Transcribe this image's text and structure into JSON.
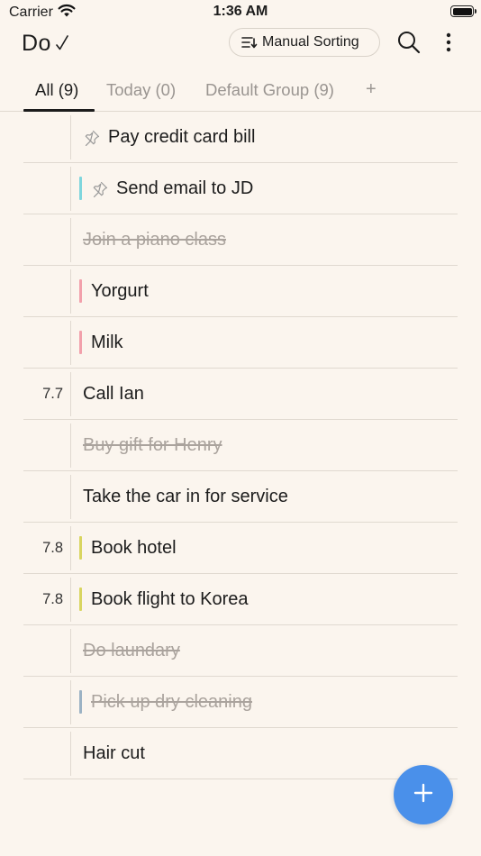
{
  "status_bar": {
    "carrier": "Carrier",
    "time": "1:36 AM"
  },
  "header": {
    "app_title": "Do",
    "sort_label": "Manual Sorting"
  },
  "tabs": [
    {
      "label": "All (9)",
      "active": true
    },
    {
      "label": "Today (0)",
      "active": false
    },
    {
      "label": "Default Group (9)",
      "active": false
    },
    {
      "label": "+"
    }
  ],
  "colors": {
    "accent": "#4a90ea",
    "background": "#fbf5ee",
    "tag_cyan": "#7fd6dd",
    "tag_pink": "#f2a0ab",
    "tag_yellow": "#d9d560",
    "tag_slate": "#9bb2c4"
  },
  "tasks": [
    {
      "title": "Pay credit card bill",
      "date": "",
      "pinned": true,
      "done": false,
      "tag": null
    },
    {
      "title": "Send email to JD",
      "date": "",
      "pinned": true,
      "done": false,
      "tag": "#7fd6dd"
    },
    {
      "title": "Join a piano class",
      "date": "",
      "pinned": false,
      "done": true,
      "tag": null
    },
    {
      "title": "Yorgurt",
      "date": "",
      "pinned": false,
      "done": false,
      "tag": "#f2a0ab"
    },
    {
      "title": "Milk",
      "date": "",
      "pinned": false,
      "done": false,
      "tag": "#f2a0ab"
    },
    {
      "title": "Call Ian",
      "date": "7.7",
      "pinned": false,
      "done": false,
      "tag": null
    },
    {
      "title": "Buy gift for Henry",
      "date": "",
      "pinned": false,
      "done": true,
      "tag": null
    },
    {
      "title": "Take the car in for service",
      "date": "",
      "pinned": false,
      "done": false,
      "tag": null
    },
    {
      "title": "Book hotel",
      "date": "7.8",
      "pinned": false,
      "done": false,
      "tag": "#d9d560"
    },
    {
      "title": "Book flight to Korea",
      "date": "7.8",
      "pinned": false,
      "done": false,
      "tag": "#d9d560"
    },
    {
      "title": "Do laundary",
      "date": "",
      "pinned": false,
      "done": true,
      "tag": null
    },
    {
      "title": "Pick up dry cleaning",
      "date": "",
      "pinned": false,
      "done": true,
      "tag": "#9bb2c4"
    },
    {
      "title": "Hair cut",
      "date": "",
      "pinned": false,
      "done": false,
      "tag": null
    }
  ],
  "icons": {
    "wifi": "wifi-icon",
    "battery": "battery-icon",
    "check": "checkmark-icon",
    "sort": "sort-icon",
    "search": "search-icon",
    "more": "more-vertical-icon",
    "pin": "pin-icon",
    "add": "plus-icon"
  }
}
